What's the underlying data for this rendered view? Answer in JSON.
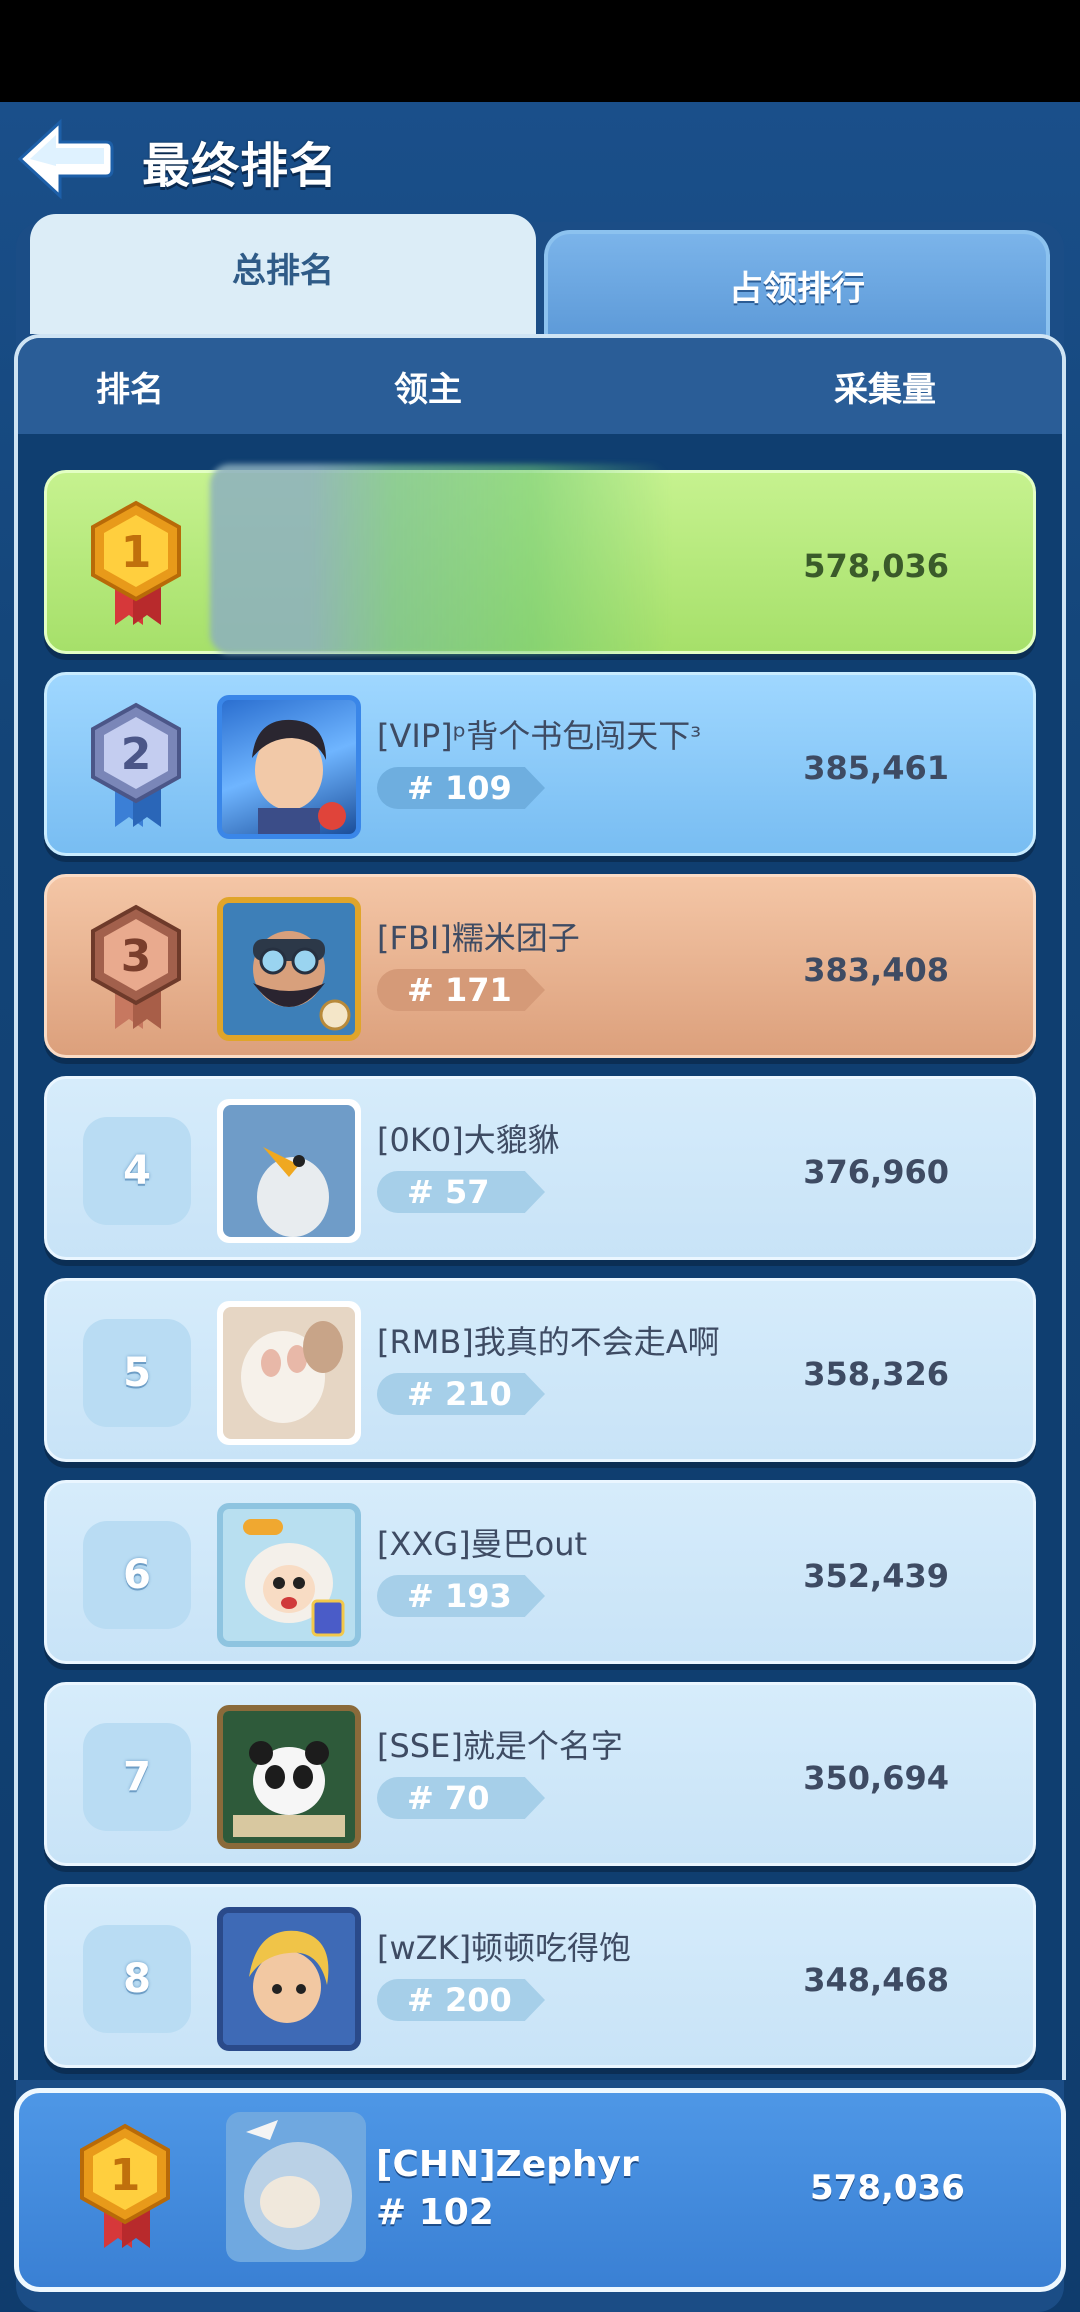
{
  "header": {
    "title": "最终排名",
    "back_icon": "arrow-left-icon"
  },
  "tabs": [
    {
      "label": "总排名",
      "active": true
    },
    {
      "label": "占领排行",
      "active": false
    }
  ],
  "columns": {
    "rank": "排名",
    "lord": "领主",
    "amount": "采集量"
  },
  "rows": [
    {
      "rank": "1",
      "name": "",
      "alliance": "",
      "amount": "578,036",
      "style": "gold",
      "blurred": true
    },
    {
      "rank": "2",
      "name": "[VIP]ᵖ背个书包闯天下ᶟ",
      "alliance": "# 109",
      "amount": "385,461",
      "style": "silver"
    },
    {
      "rank": "3",
      "name": "[FBI]糯米团子",
      "alliance": "# 171",
      "amount": "383,408",
      "style": "bronze"
    },
    {
      "rank": "4",
      "name": "[0K0]大貔貅",
      "alliance": "# 57",
      "amount": "376,960",
      "style": "plain"
    },
    {
      "rank": "5",
      "name": "[RMB]我真的不会走A啊",
      "alliance": "# 210",
      "amount": "358,326",
      "style": "plain"
    },
    {
      "rank": "6",
      "name": "[XXG]曼巴out",
      "alliance": "# 193",
      "amount": "352,439",
      "style": "plain"
    },
    {
      "rank": "7",
      "name": "[SSE]就是个名字",
      "alliance": "# 70",
      "amount": "350,694",
      "style": "plain"
    },
    {
      "rank": "8",
      "name": "[wZK]顿顿吃得饱",
      "alliance": "# 200",
      "amount": "348,468",
      "style": "plain"
    }
  ],
  "me": {
    "rank": "1",
    "name": "[CHN]Zephyr",
    "alliance": "# 102",
    "amount": "578,036"
  },
  "colors": {
    "gold_row": "#b4e87a",
    "silver_row": "#8ccaf8",
    "bronze_row": "#e8b392",
    "plain_row": "#d0e8f8",
    "me_row": "#4589dc"
  }
}
